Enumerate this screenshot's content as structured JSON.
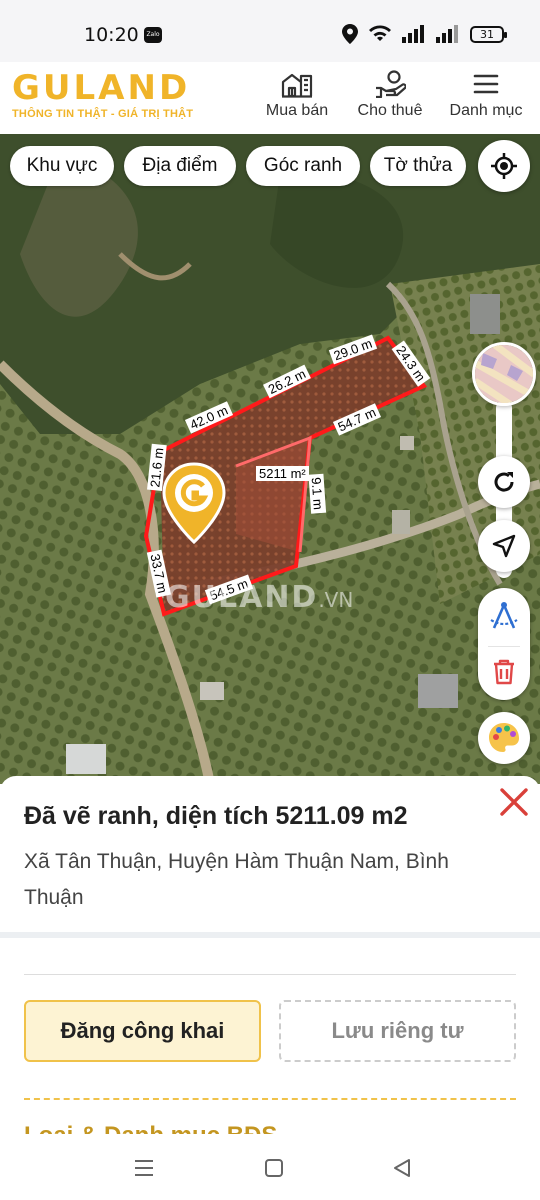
{
  "status_bar": {
    "time": "10:20",
    "notification": "Zalo",
    "battery": "31"
  },
  "header": {
    "logo_text": "GULAND",
    "tagline": "THÔNG TIN THẬT - GIÁ TRỊ THẬT",
    "nav": [
      {
        "label": "Mua bán",
        "icon": "buildings-icon"
      },
      {
        "label": "Cho thuê",
        "icon": "hand-key-icon"
      },
      {
        "label": "Danh mục",
        "icon": "menu-icon"
      }
    ]
  },
  "map": {
    "filters": [
      "Khu vực",
      "Địa điểm",
      "Góc ranh",
      "Tờ thửa"
    ],
    "area_label": "5211 m²",
    "edge_labels": [
      "42.0 m",
      "26.2 m",
      "29.0 m",
      "24.3 m",
      "54.7 m",
      "9.1 m",
      "54.5 m",
      "33.7 m",
      "21.6 m"
    ],
    "watermark_main": "GULAND",
    "watermark_suffix": ".VN",
    "accent_color": "#f0b429",
    "boundary_color": "#ff1a1a"
  },
  "sheet": {
    "title": "Đã vẽ ranh, diện tích 5211.09 m2",
    "address": "Xã Tân Thuận, Huyện Hàm Thuận Nam, Bình Thuận",
    "public_button": "Đăng công khai",
    "private_button": "Lưu riêng tư",
    "next_section": "Loại & Danh mục BĐS"
  }
}
